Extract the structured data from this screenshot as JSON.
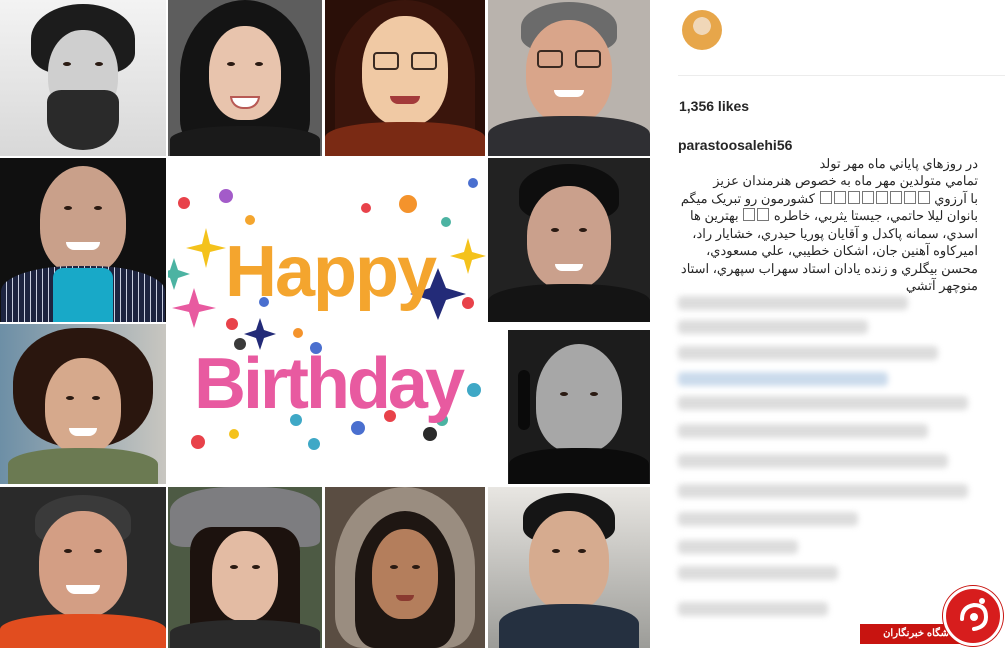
{
  "post": {
    "username": "parastoosalehi56",
    "likes": "1,356 likes",
    "caption_lines": [
      "در روزهاي پاياني ماه مهر تولد",
      "تمامي متولدين مهر ماه به خصوص هنرمندان عزيز",
      "با آرزوي",
      "کشورمون رو تبريک ميگم",
      "بانوان ليلا حاتمي، جيستا يثربي، خاطره",
      "بهترين ها",
      "اسدي، سمانه پاکدل و آقايان پوريا حيدري، خشايار راد،",
      "اميرکاوه آهنين جان، اشکان خطيبي، علي مسعودي،",
      "محسن بيگلري و زنده يادان استاد سهراب سپهري، استاد",
      "منوچهر آتشي"
    ]
  },
  "birthday_card": {
    "line1": "Happy",
    "line2": "Birthday"
  },
  "watermark": {
    "label": "باشگاه خبرنگاران"
  },
  "colors": {
    "accent_red": "#c81410",
    "text": "#262626",
    "divider": "#ececec"
  },
  "icons": [
    "avatar",
    "watermark-logo-icon"
  ]
}
